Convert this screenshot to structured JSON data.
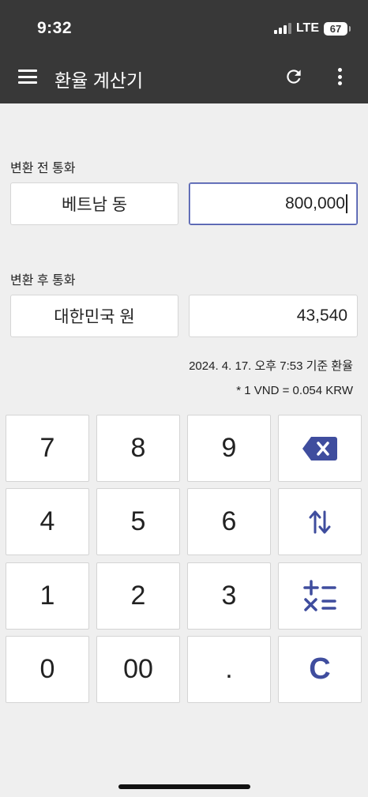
{
  "status": {
    "time": "9:32",
    "network": "LTE",
    "battery": "67"
  },
  "appbar": {
    "title": "환율 계산기"
  },
  "from": {
    "label": "변환 전 통화",
    "currency": "베트남 동",
    "amount": "800,000"
  },
  "to": {
    "label": "변환 후 통화",
    "currency": "대한민국 원",
    "amount": "43,540"
  },
  "rate": {
    "timestamp": "2024. 4. 17. 오후 7:53 기준 환율",
    "value": "* 1 VND = 0.054 KRW"
  },
  "keypad": {
    "k7": "7",
    "k8": "8",
    "k9": "9",
    "k4": "4",
    "k5": "5",
    "k6": "6",
    "k1": "1",
    "k2": "2",
    "k3": "3",
    "k0": "0",
    "k00": "00",
    "kdot": ".",
    "kclear": "C"
  },
  "colors": {
    "accent": "#3f4d9e",
    "appbar": "#383838",
    "background": "#efefef"
  },
  "icons": [
    "menu-icon",
    "refresh-icon",
    "more-vert-icon",
    "backspace-icon",
    "swap-icon",
    "calculator-icon"
  ]
}
